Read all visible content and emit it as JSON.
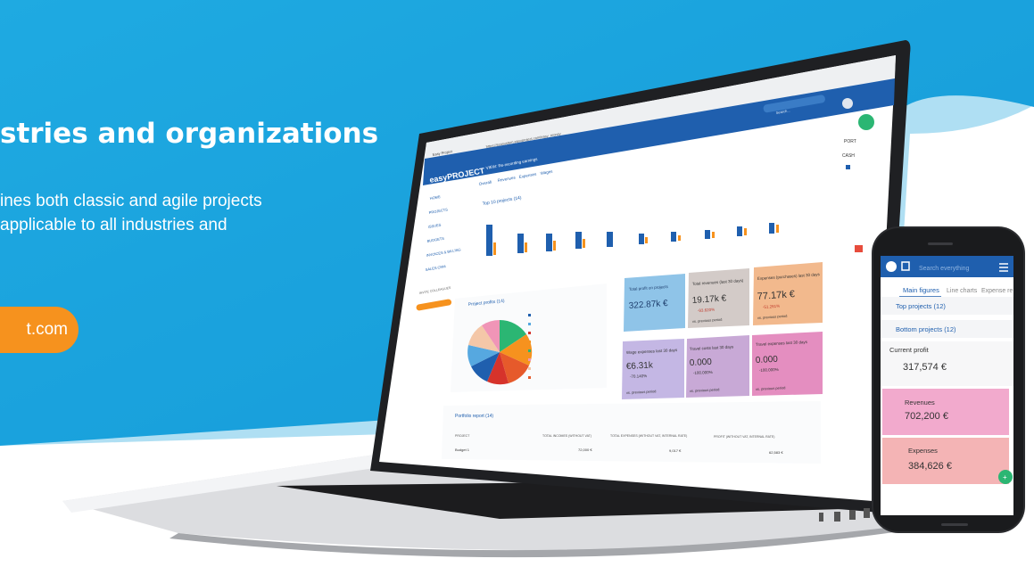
{
  "hero": {
    "title": "stries and organizations",
    "text_line1": "ines both classic and agile projects",
    "text_line2": "applicable to all industries and",
    "cta_label": "t.com"
  },
  "colors": {
    "sky": "#1aa3dd",
    "sky_dark": "#0f86c8",
    "brand_blue": "#1f5fae",
    "cta_orange": "#f6921e",
    "accent_green": "#2bb673"
  },
  "browser": {
    "tab_title": "Easy Project",
    "url": "https://ecosystem.easyproject.com/easy_money",
    "search_placeholder": "Q Search"
  },
  "app": {
    "logo": "easyPROJECT",
    "module_title": "VIEW: Re-recording earnings",
    "search_placeholder": "Search...",
    "sidebar": [
      "HOME",
      "PROJECTS",
      "ISSUES",
      "BUDGETS",
      "INVOICES & BILLING",
      "SALES CRM"
    ],
    "invite_label": "INVITE COLLEAGUES",
    "tabs": [
      "Overall",
      "Revenues",
      "Expenses",
      "Wages"
    ],
    "top_projects_title": "Top 10 projects (14)",
    "project_profits_title": "Project profits (14)",
    "portfolio_title": "Portfolio report (14)",
    "portfolio_headers": [
      "PROJECT",
      "TOTAL INCOMES (WITHOUT VAT)",
      "TOTAL EXPENSES (WITHOUT VAT, INTERNAL RATE)",
      "PROFIT (WITHOUT VAT, INTERNAL RATE)"
    ],
    "portfolio_row": [
      "Budget 1",
      "72,000 €",
      "9,017 €",
      "62,583 €"
    ],
    "right_labels": [
      "PORT",
      "CASH"
    ]
  },
  "tiles": [
    {
      "label": "Total profit on projects",
      "value": "322.87k €",
      "change": "",
      "footer": ""
    },
    {
      "label": "Total revenues (last 30 days)",
      "value": "19.17k €",
      "change": "-93.620%",
      "footer": "vs. previous period"
    },
    {
      "label": "Expenses (purchases) last 30 days",
      "value": "77.17k €",
      "change": "-51.261%",
      "footer": "vs. previous period"
    },
    {
      "label": "Wage expenses last 30 days",
      "value": "€6.31k",
      "change": "-70.140%",
      "footer": "vs. previous period"
    },
    {
      "label": "Travel costs last 30 days",
      "value": "0.000",
      "change": "-100.000%",
      "footer": "vs. previous period"
    },
    {
      "label": "Travel expenses last 30 days",
      "value": "0.000",
      "change": "-100.000%",
      "footer": "vs. previous period"
    }
  ],
  "phone": {
    "search_placeholder": "Search everything",
    "tabs": [
      "Main figures",
      "Line charts",
      "Expense re"
    ],
    "list_items": [
      "Top projects (12)",
      "Bottom projects (12)"
    ],
    "current_profit_label": "Current profit",
    "current_profit_value": "317,574 €",
    "revenues_label": "Revenues",
    "revenues_value": "702,200 €",
    "expenses_label": "Expenses",
    "expenses_value": "384,626 €",
    "fab_label": "+"
  }
}
